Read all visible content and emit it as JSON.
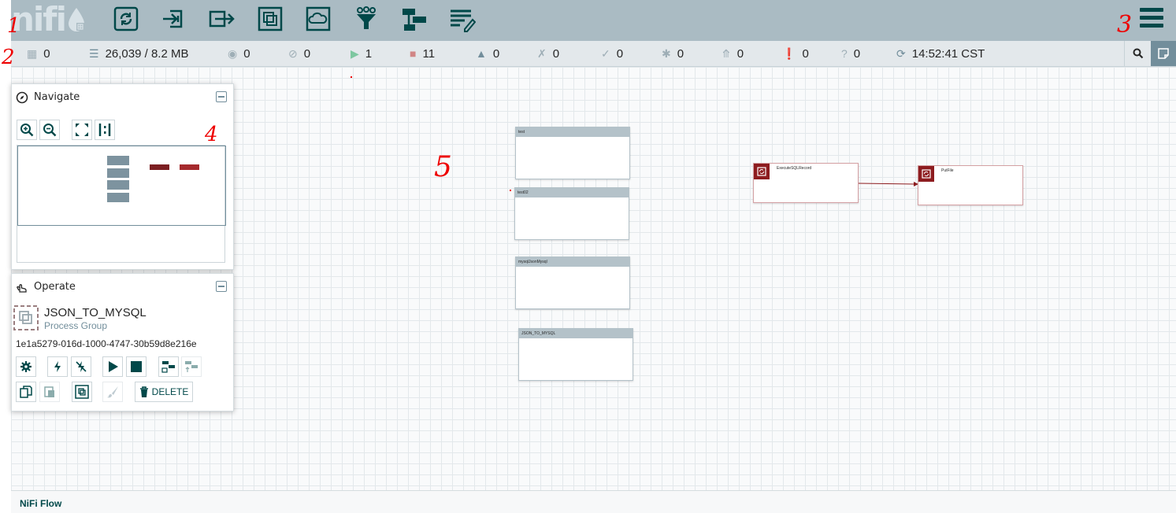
{
  "header": {
    "logo_text": "nifi",
    "components": [
      {
        "name": "processor-icon"
      },
      {
        "name": "input-port-icon"
      },
      {
        "name": "output-port-icon"
      },
      {
        "name": "process-group-icon"
      },
      {
        "name": "remote-process-group-icon"
      },
      {
        "name": "funnel-icon"
      },
      {
        "name": "template-icon"
      },
      {
        "name": "label-icon"
      }
    ],
    "menu_icon": "hamburger-menu-icon"
  },
  "status": {
    "cluster_count": "0",
    "queued": "26,039 / 8.2 MB",
    "transmitting": "0",
    "not_transmitting": "0",
    "running": "1",
    "stopped": "11",
    "invalid": "0",
    "disabled": "0",
    "up_to_date": "0",
    "locally_modified": "0",
    "stale": "0",
    "locally_modified_stale": "0",
    "sync_failure": "0",
    "last_refreshed": "14:52:41 CST"
  },
  "canvas": {
    "process_groups": [
      {
        "name": "test"
      },
      {
        "name": "test02"
      },
      {
        "name": "mysqlJsonMysql"
      },
      {
        "name": "JSON_TO_MYSQL"
      }
    ],
    "processors": [
      {
        "name": "ExecuteSQLRecord"
      },
      {
        "name": "PutFile"
      }
    ]
  },
  "navigate": {
    "title": "Navigate"
  },
  "operate": {
    "title": "Operate",
    "component_name": "JSON_TO_MYSQL",
    "component_type": "Process Group",
    "component_id": "1e1a5279-016d-1000-4747-30b59d8e216e",
    "delete_label": "DELETE"
  },
  "breadcrumb": {
    "label": "NiFi Flow"
  },
  "annotations": [
    "1",
    "2",
    "3",
    "4",
    "5"
  ],
  "colors": {
    "header_bg": "#aabbc3",
    "icon_teal": "#004849",
    "processor_red": "#8d1c1f",
    "running_green": "#7dc7a0",
    "stopped_red": "#d18686",
    "annotation_red": "#e00000"
  }
}
